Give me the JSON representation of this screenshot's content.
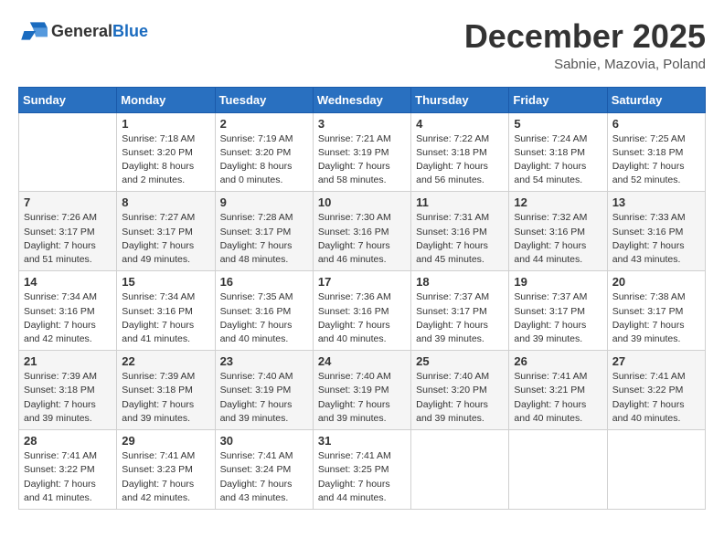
{
  "header": {
    "logo_general": "General",
    "logo_blue": "Blue",
    "month": "December 2025",
    "location": "Sabnie, Mazovia, Poland"
  },
  "weekdays": [
    "Sunday",
    "Monday",
    "Tuesday",
    "Wednesday",
    "Thursday",
    "Friday",
    "Saturday"
  ],
  "weeks": [
    [
      {
        "day": "",
        "detail": ""
      },
      {
        "day": "1",
        "detail": "Sunrise: 7:18 AM\nSunset: 3:20 PM\nDaylight: 8 hours\nand 2 minutes."
      },
      {
        "day": "2",
        "detail": "Sunrise: 7:19 AM\nSunset: 3:20 PM\nDaylight: 8 hours\nand 0 minutes."
      },
      {
        "day": "3",
        "detail": "Sunrise: 7:21 AM\nSunset: 3:19 PM\nDaylight: 7 hours\nand 58 minutes."
      },
      {
        "day": "4",
        "detail": "Sunrise: 7:22 AM\nSunset: 3:18 PM\nDaylight: 7 hours\nand 56 minutes."
      },
      {
        "day": "5",
        "detail": "Sunrise: 7:24 AM\nSunset: 3:18 PM\nDaylight: 7 hours\nand 54 minutes."
      },
      {
        "day": "6",
        "detail": "Sunrise: 7:25 AM\nSunset: 3:18 PM\nDaylight: 7 hours\nand 52 minutes."
      }
    ],
    [
      {
        "day": "7",
        "detail": "Sunrise: 7:26 AM\nSunset: 3:17 PM\nDaylight: 7 hours\nand 51 minutes."
      },
      {
        "day": "8",
        "detail": "Sunrise: 7:27 AM\nSunset: 3:17 PM\nDaylight: 7 hours\nand 49 minutes."
      },
      {
        "day": "9",
        "detail": "Sunrise: 7:28 AM\nSunset: 3:17 PM\nDaylight: 7 hours\nand 48 minutes."
      },
      {
        "day": "10",
        "detail": "Sunrise: 7:30 AM\nSunset: 3:16 PM\nDaylight: 7 hours\nand 46 minutes."
      },
      {
        "day": "11",
        "detail": "Sunrise: 7:31 AM\nSunset: 3:16 PM\nDaylight: 7 hours\nand 45 minutes."
      },
      {
        "day": "12",
        "detail": "Sunrise: 7:32 AM\nSunset: 3:16 PM\nDaylight: 7 hours\nand 44 minutes."
      },
      {
        "day": "13",
        "detail": "Sunrise: 7:33 AM\nSunset: 3:16 PM\nDaylight: 7 hours\nand 43 minutes."
      }
    ],
    [
      {
        "day": "14",
        "detail": "Sunrise: 7:34 AM\nSunset: 3:16 PM\nDaylight: 7 hours\nand 42 minutes."
      },
      {
        "day": "15",
        "detail": "Sunrise: 7:34 AM\nSunset: 3:16 PM\nDaylight: 7 hours\nand 41 minutes."
      },
      {
        "day": "16",
        "detail": "Sunrise: 7:35 AM\nSunset: 3:16 PM\nDaylight: 7 hours\nand 40 minutes."
      },
      {
        "day": "17",
        "detail": "Sunrise: 7:36 AM\nSunset: 3:16 PM\nDaylight: 7 hours\nand 40 minutes."
      },
      {
        "day": "18",
        "detail": "Sunrise: 7:37 AM\nSunset: 3:17 PM\nDaylight: 7 hours\nand 39 minutes."
      },
      {
        "day": "19",
        "detail": "Sunrise: 7:37 AM\nSunset: 3:17 PM\nDaylight: 7 hours\nand 39 minutes."
      },
      {
        "day": "20",
        "detail": "Sunrise: 7:38 AM\nSunset: 3:17 PM\nDaylight: 7 hours\nand 39 minutes."
      }
    ],
    [
      {
        "day": "21",
        "detail": "Sunrise: 7:39 AM\nSunset: 3:18 PM\nDaylight: 7 hours\nand 39 minutes."
      },
      {
        "day": "22",
        "detail": "Sunrise: 7:39 AM\nSunset: 3:18 PM\nDaylight: 7 hours\nand 39 minutes."
      },
      {
        "day": "23",
        "detail": "Sunrise: 7:40 AM\nSunset: 3:19 PM\nDaylight: 7 hours\nand 39 minutes."
      },
      {
        "day": "24",
        "detail": "Sunrise: 7:40 AM\nSunset: 3:19 PM\nDaylight: 7 hours\nand 39 minutes."
      },
      {
        "day": "25",
        "detail": "Sunrise: 7:40 AM\nSunset: 3:20 PM\nDaylight: 7 hours\nand 39 minutes."
      },
      {
        "day": "26",
        "detail": "Sunrise: 7:41 AM\nSunset: 3:21 PM\nDaylight: 7 hours\nand 40 minutes."
      },
      {
        "day": "27",
        "detail": "Sunrise: 7:41 AM\nSunset: 3:22 PM\nDaylight: 7 hours\nand 40 minutes."
      }
    ],
    [
      {
        "day": "28",
        "detail": "Sunrise: 7:41 AM\nSunset: 3:22 PM\nDaylight: 7 hours\nand 41 minutes."
      },
      {
        "day": "29",
        "detail": "Sunrise: 7:41 AM\nSunset: 3:23 PM\nDaylight: 7 hours\nand 42 minutes."
      },
      {
        "day": "30",
        "detail": "Sunrise: 7:41 AM\nSunset: 3:24 PM\nDaylight: 7 hours\nand 43 minutes."
      },
      {
        "day": "31",
        "detail": "Sunrise: 7:41 AM\nSunset: 3:25 PM\nDaylight: 7 hours\nand 44 minutes."
      },
      {
        "day": "",
        "detail": ""
      },
      {
        "day": "",
        "detail": ""
      },
      {
        "day": "",
        "detail": ""
      }
    ]
  ]
}
